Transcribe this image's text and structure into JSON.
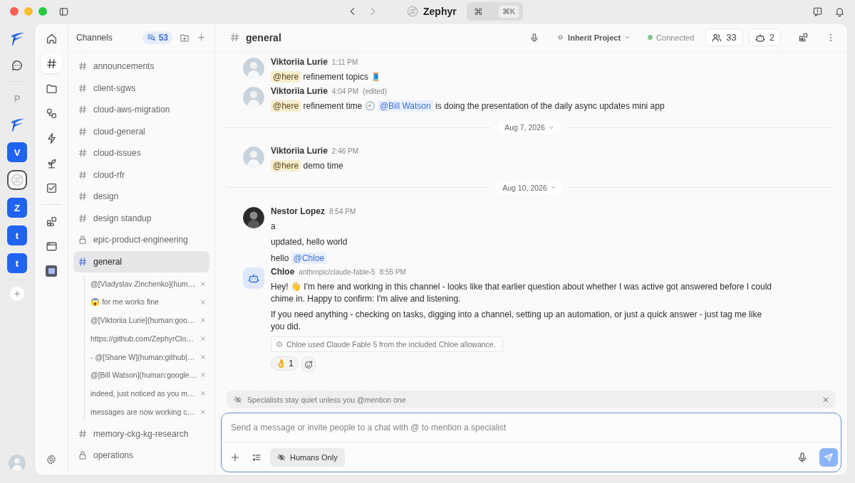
{
  "window": {
    "title": "Zephyr",
    "command_icon": "⌘",
    "command_shortcut": "⌘K"
  },
  "workspaces": [
    {
      "kind": "logo",
      "selected": false
    },
    {
      "kind": "chat",
      "selected": false
    },
    {
      "kind": "letter",
      "label": "P",
      "faded": true,
      "selected": false
    },
    {
      "kind": "logo",
      "selected": false
    },
    {
      "kind": "letter",
      "label": "V",
      "faded": false,
      "selected": false
    },
    {
      "kind": "ring",
      "selected": true
    },
    {
      "kind": "letter",
      "label": "Z",
      "faded": false,
      "selected": false
    },
    {
      "kind": "letter",
      "label": "t",
      "faded": false,
      "selected": false
    },
    {
      "kind": "letter",
      "label": "t",
      "faded": false,
      "selected": false
    },
    {
      "kind": "add",
      "selected": false
    }
  ],
  "nav": [
    {
      "kind": "home",
      "selected": false
    },
    {
      "kind": "hash",
      "selected": true
    },
    {
      "kind": "folder",
      "selected": false
    },
    {
      "kind": "flow",
      "selected": false
    },
    {
      "kind": "bolt",
      "selected": false
    },
    {
      "kind": "sprout",
      "selected": false
    },
    {
      "kind": "tasks",
      "selected": false
    },
    {
      "kind": "apps",
      "selected": false
    },
    {
      "kind": "window",
      "selected": false
    },
    {
      "kind": "book",
      "selected": false
    }
  ],
  "channels": {
    "title": "Channels",
    "count": "53",
    "items": [
      {
        "kind": "public",
        "name": "announcements",
        "selected": false
      },
      {
        "kind": "public",
        "name": "client-sgws",
        "selected": false
      },
      {
        "kind": "public",
        "name": "cloud-aws-migration",
        "selected": false
      },
      {
        "kind": "public",
        "name": "cloud-general",
        "selected": false
      },
      {
        "kind": "public",
        "name": "cloud-issues",
        "selected": false
      },
      {
        "kind": "public",
        "name": "cloud-rfr",
        "selected": false
      },
      {
        "kind": "public",
        "name": "design",
        "selected": false
      },
      {
        "kind": "public",
        "name": "design standup",
        "selected": false
      },
      {
        "kind": "private",
        "name": "epic-product-engineering",
        "selected": false
      },
      {
        "kind": "public",
        "name": "general",
        "selected": true,
        "expanded": true,
        "children": [
          {
            "label": "@[Vladyslav Zinchenko](hum…"
          },
          {
            "label": "😱 for me works fine"
          },
          {
            "label": "@[Viktoriia Lurie](human:goo…"
          },
          {
            "label": "https://github.com/ZephyrClo…"
          },
          {
            "label": "- @[Shane W](human:github|…"
          },
          {
            "label": "@[Bill Watson](human:google…"
          },
          {
            "label": "indeed, just noticed as you m…"
          },
          {
            "label": "messages are now working c…"
          }
        ]
      },
      {
        "kind": "public",
        "name": "memory-ckg-kg-research",
        "selected": false
      },
      {
        "kind": "private",
        "name": "operations",
        "selected": false
      }
    ]
  },
  "header": {
    "channel": "general",
    "project": "Inherit Project",
    "status": {
      "label": "Connected",
      "online": true
    },
    "members": "33",
    "bots": "2"
  },
  "messages": [
    {
      "kind": "message",
      "author": "Viktoriia Lurie",
      "time": "1:11 PM",
      "avatar": {
        "kind": "person"
      },
      "paragraphs": [
        [
          {
            "kind": "here",
            "text": "@here"
          },
          {
            "kind": "text",
            "text": "refinement topics 🧵"
          }
        ]
      ]
    },
    {
      "kind": "message",
      "author": "Viktoriia Lurie",
      "time": "4:04 PM",
      "edited": "(edited)",
      "avatar": {
        "kind": "person"
      },
      "paragraphs": [
        [
          {
            "kind": "here",
            "text": "@here"
          },
          {
            "kind": "text",
            "text": "refinement time 🕘"
          },
          {
            "kind": "mention",
            "text": "@Bill Watson"
          },
          {
            "kind": "text",
            "text": "is doing the presentation of the daily async updates mini app"
          }
        ]
      ]
    },
    {
      "kind": "date",
      "label": "Aug 7, 2026"
    },
    {
      "kind": "message",
      "author": "Viktoriia Lurie",
      "time": "2:46 PM",
      "avatar": {
        "kind": "person"
      },
      "paragraphs": [
        [
          {
            "kind": "here",
            "text": "@here"
          },
          {
            "kind": "text",
            "text": "demo time"
          }
        ]
      ]
    },
    {
      "kind": "date",
      "label": "Aug 10, 2026"
    },
    {
      "kind": "message",
      "author": "Nestor Lopez",
      "time": "8:54 PM",
      "avatar": {
        "kind": "person_dark"
      },
      "paragraphs": [
        [
          {
            "kind": "text",
            "text": "a"
          }
        ],
        [
          {
            "kind": "text",
            "text": "updated, hello world"
          }
        ],
        [
          {
            "kind": "text",
            "text": "hello"
          },
          {
            "kind": "mention",
            "text": "@Chloe"
          }
        ]
      ]
    },
    {
      "kind": "message",
      "author": "Chloe",
      "model": "anthropic/claude-fable-5",
      "time": "8:55 PM",
      "avatar": {
        "kind": "bot"
      },
      "paragraphs": [
        [
          {
            "kind": "text",
            "text": "Hey! 👋 I'm here and working in this channel - looks like that earlier question about whether I was active got answered before I could chime in. Happy to confirm: I'm alive and listening."
          }
        ],
        [
          {
            "kind": "text",
            "text": "If you need anything - checking on tasks, digging into a channel, setting up an automation, or just a quick answer - just tag me like you did."
          }
        ]
      ],
      "notice": "Chloe used Claude Fable 5 from the included Chloe allowance.",
      "reactions": [
        {
          "emoji": "👌",
          "count": "1"
        }
      ]
    }
  ],
  "banner": "Specialists stay quiet unless you @mention one",
  "composer": {
    "placeholder": "Send a message or invite people to a chat with @ to mention a specialist",
    "mode": "Humans Only"
  }
}
